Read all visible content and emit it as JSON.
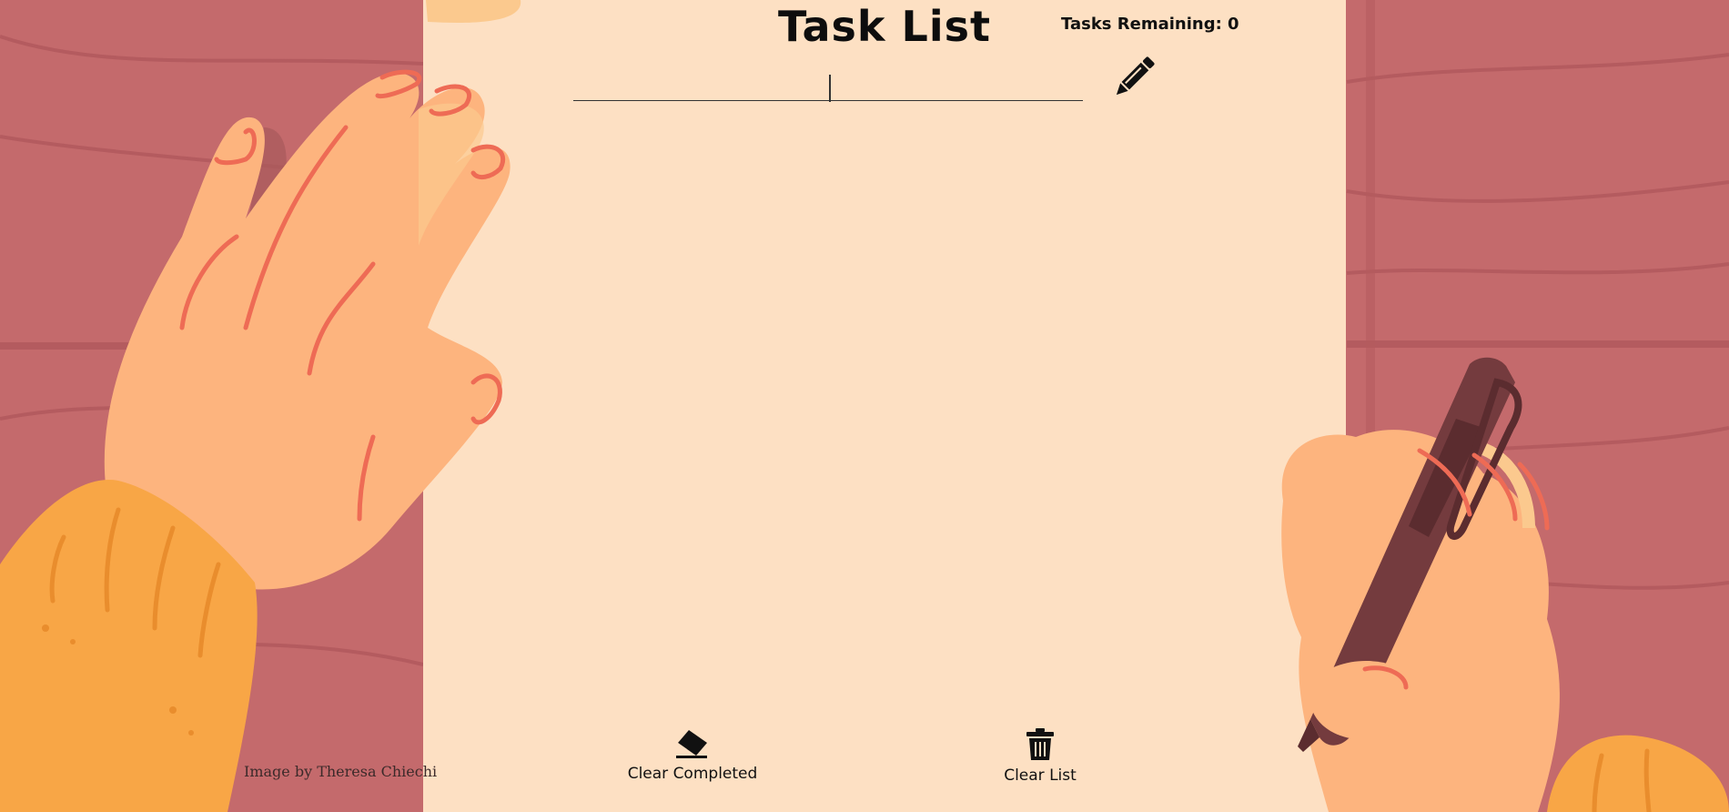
{
  "app": {
    "title": "Task List",
    "tasks_remaining_label": "Tasks Remaining: 0"
  },
  "task_input": {
    "value": "",
    "placeholder": ""
  },
  "footer": {
    "clear_completed_label": "Clear Completed",
    "clear_list_label": "Clear List"
  },
  "credit": "Image by Theresa Chiechi",
  "colors": {
    "desk": "#c46a6c",
    "paper": "#fde0c3",
    "skin": "#fdb47e",
    "nail": "#ee6b55",
    "sleeve": "#f8a646",
    "pen": "#743b3e"
  },
  "icons": {
    "add": "pencil-icon",
    "clear_completed": "eraser-icon",
    "clear_list": "trash-icon"
  }
}
